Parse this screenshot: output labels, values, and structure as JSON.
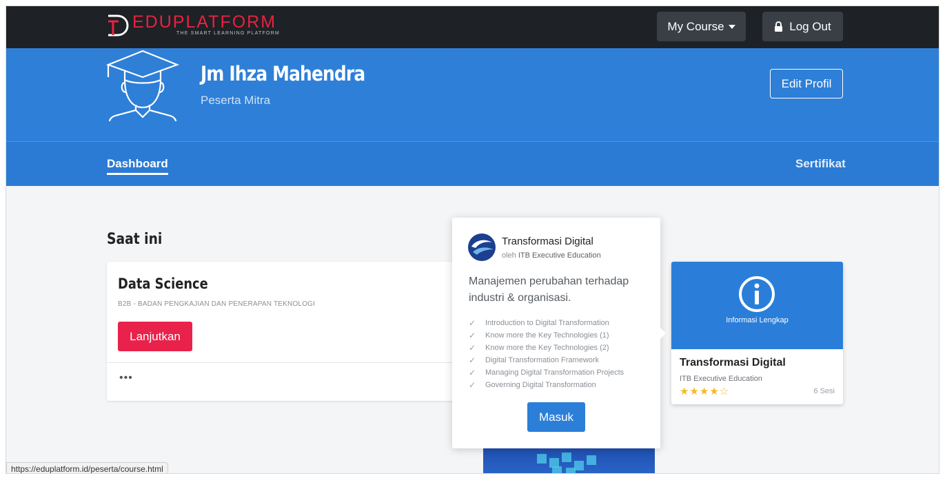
{
  "navbar": {
    "logo_text": "EDUPLATFORM",
    "logo_tagline": "THE SMART LEARNING PLATFORM",
    "my_course_label": "My Course",
    "logout_label": "Log Out"
  },
  "profile": {
    "name": "Jm Ihza Mahendra",
    "role": "Peserta Mitra",
    "edit_label": "Edit Profil"
  },
  "tabs": {
    "dashboard": "Dashboard",
    "certificate": "Sertifikat"
  },
  "current": {
    "section_title": "Saat ini",
    "course": {
      "title": "Data Science",
      "org": "B2B - BADAN PENGKAJIAN DAN PENERAPAN TEKNOLOGI",
      "continue_label": "Lanjutkan",
      "more": "•••"
    }
  },
  "popover": {
    "title": "Transformasi Digital",
    "by_prefix": "oleh",
    "by_org": "ITB Executive Education",
    "description": "Manajemen perubahan terhadap industri & organisasi.",
    "modules": [
      "Introduction to Digital Transformation",
      "Know more the Key Technologies (1)",
      "Know more the Key Technologies (2)",
      "Digital Transformation Framework",
      "Managing Digital Transformation Projects",
      "Governing Digital Transformation"
    ],
    "enter_label": "Masuk"
  },
  "course_card": {
    "info_label": "Informasi Lengkap",
    "title": "Transformasi Digital",
    "org": "ITB Executive Education",
    "rating": 4,
    "rating_max": 5,
    "stars_text": "★★★★",
    "star_empty_text": "☆",
    "sessions": "6 Sesi"
  },
  "statusbar": {
    "url": "https://eduplatform.id/peserta/course.html"
  },
  "colors": {
    "navbar": "#1e2126",
    "primary_blue": "#2d7fd9",
    "accent_red": "#e8224a",
    "star": "#f5b921"
  }
}
